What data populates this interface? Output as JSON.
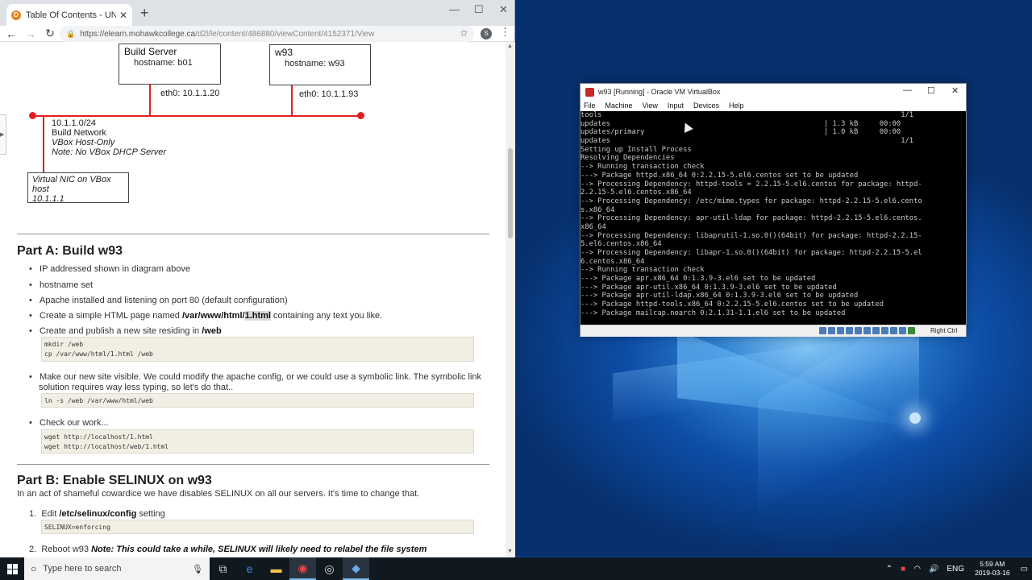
{
  "browser": {
    "tab_title": "Table Of Contents - UNIX Securit",
    "url_host": "https://elearn.mohawkcollege.ca",
    "url_path": "/d2l/le/content/486880/viewContent/4152371/View",
    "profile_initial": "S"
  },
  "diagram": {
    "build_server_title": "Build Server",
    "build_server_host": "hostname: b01",
    "w93_title": "w93",
    "w93_host": "hostname: w93",
    "eth_b01": "eth0: 10.1.1.20",
    "eth_w93": "eth0: 10.1.1.93",
    "net_lines": [
      "10.1.1.0/24",
      "Build Network",
      "VBox Host-Only",
      "Note: No VBox DHCP Server"
    ],
    "vnic_lines": [
      "Virtual NIC on VBox",
      "host",
      "10.1.1.1"
    ]
  },
  "partA": {
    "heading": "Part A: Build w93",
    "b1": "IP addressed shown in diagram above",
    "b2": "hostname set",
    "b3": "Apache installed and listening on port 80 (default configuration)",
    "b4_pre": "Create a simple HTML page named ",
    "b4_path": "/var/www/html/",
    "b4_file": "1.html",
    "b4_post": " containing any text you like.",
    "b5_pre": "Create and publish a new site residing in ",
    "b5_path": "/web",
    "code1": "mkdir /web\ncp /var/www/html/1.html /web",
    "b6_line1": "Make our new site visible. We could modify the apache config, or we could use a symbolic link. The symbolic link",
    "b6_line2": "solution requires way less typing, so let's do that..",
    "code2": "ln -s /web /var/www/html/web",
    "b7": "Check our work...",
    "code3": "wget http://localhost/1.html\nwget http://localhost/web/1.html"
  },
  "partB": {
    "heading": "Part B: Enable SELINUX on w93",
    "intro": "In an act of shameful cowardice we have disables SELINUX on all our servers. It's time to change that.",
    "s1_num": "1.",
    "s1_pre": "Edit ",
    "s1_path": "/etc/selinux/config",
    "s1_post": " setting",
    "code4": "SELINUX=enforcing",
    "s2_num": "2.",
    "s2_pre": "Reboot w93 ",
    "s2_note": "Note: This could take a while, SELINUX will likely need to relabel the file system"
  },
  "vbox": {
    "title": "w93 [Running] - Oracle VM VirtualBox",
    "menu": [
      "File",
      "Machine",
      "View",
      "Input",
      "Devices",
      "Help"
    ],
    "right_ctrl": "Right Ctrl",
    "terminal": [
      "tools                                                                      1/1",
      "updates                                                  | 1.3 kB     00:00",
      "updates/primary                                          | 1.0 kB     00:00",
      "updates                                                                    1/1",
      "Setting up Install Process",
      "Resolving Dependencies",
      "--> Running transaction check",
      "---> Package httpd.x86_64 0:2.2.15-5.el6.centos set to be updated",
      "--> Processing Dependency: httpd-tools = 2.2.15-5.el6.centos for package: httpd-",
      "2.2.15-5.el6.centos.x86_64",
      "--> Processing Dependency: /etc/mime.types for package: httpd-2.2.15-5.el6.cento",
      "s.x86_64",
      "--> Processing Dependency: apr-util-ldap for package: httpd-2.2.15-5.el6.centos.",
      "x86_64",
      "--> Processing Dependency: libaprutil-1.so.0()(64bit) for package: httpd-2.2.15-",
      "5.el6.centos.x86_64",
      "--> Processing Dependency: libapr-1.so.0()(64bit) for package: httpd-2.2.15-5.el",
      "6.centos.x86_64",
      "--> Running transaction check",
      "---> Package apr.x86_64 0:1.3.9-3.el6 set to be updated",
      "---> Package apr-util.x86_64 0:1.3.9-3.el6 set to be updated",
      "---> Package apr-util-ldap.x86_64 0:1.3.9-3.el6 set to be updated",
      "---> Package httpd-tools.x86_64 0:2.2.15-5.el6.centos set to be updated",
      "---> Package mailcap.noarch 0:2.1.31-1.1.el6 set to be updated"
    ]
  },
  "taskbar": {
    "search_placeholder": "Type here to search",
    "lang": "ENG",
    "time": "5:59 AM",
    "date": "2019-03-16"
  }
}
